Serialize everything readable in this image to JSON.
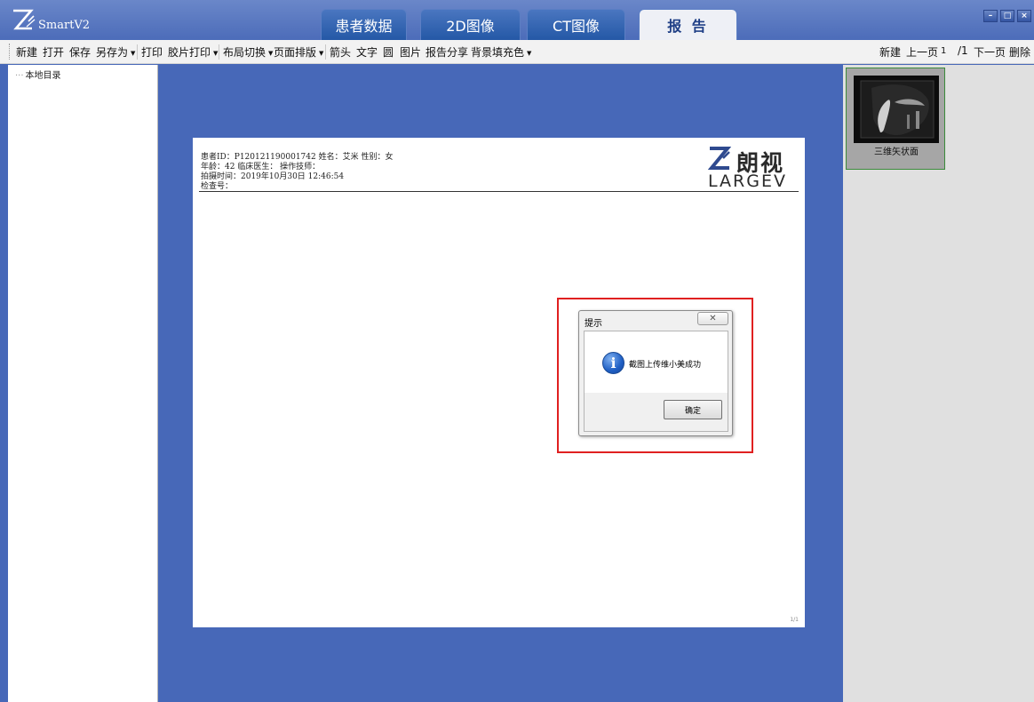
{
  "app": {
    "name": "SmartV2"
  },
  "tabs": [
    {
      "label": "患者数据"
    },
    {
      "label": "2D图像"
    },
    {
      "label": "CT图像"
    },
    {
      "label": "报 告"
    }
  ],
  "window_controls": {
    "minimize": "–",
    "maximize": "□",
    "close": "×"
  },
  "toolbar": {
    "left": [
      "新建",
      "打开",
      "保存",
      "另存为",
      "打印",
      "胶片打印",
      "布局切换",
      "页面排版",
      "箭头",
      "文字",
      "圆",
      "图片",
      "报告分享",
      "背景填充色"
    ],
    "right": {
      "new": "新建",
      "prev": "上一页",
      "page_input": "1",
      "page_total": "/1",
      "next": "下一页",
      "delete": "删除"
    }
  },
  "tree": {
    "root": "本地目录"
  },
  "report": {
    "line1": "患者ID：P120121190001742  姓名：艾米  性别：女",
    "line2": "年龄：42  临床医生：   操作技师：",
    "line3": "拍摄时间：2019年10月30日 12:46:54",
    "line4": "检查号：",
    "brand_cn": "朗视",
    "brand_en": "LARGEV",
    "page_number": "1/1"
  },
  "thumbnail": {
    "label": "三维矢状面"
  },
  "dialog": {
    "title": "提示",
    "close": "✕",
    "icon": "info-icon",
    "message": "截图上传维小美成功",
    "ok": "确定"
  },
  "colors": {
    "workspace": "#4768b8",
    "highlight": "#e02020"
  }
}
